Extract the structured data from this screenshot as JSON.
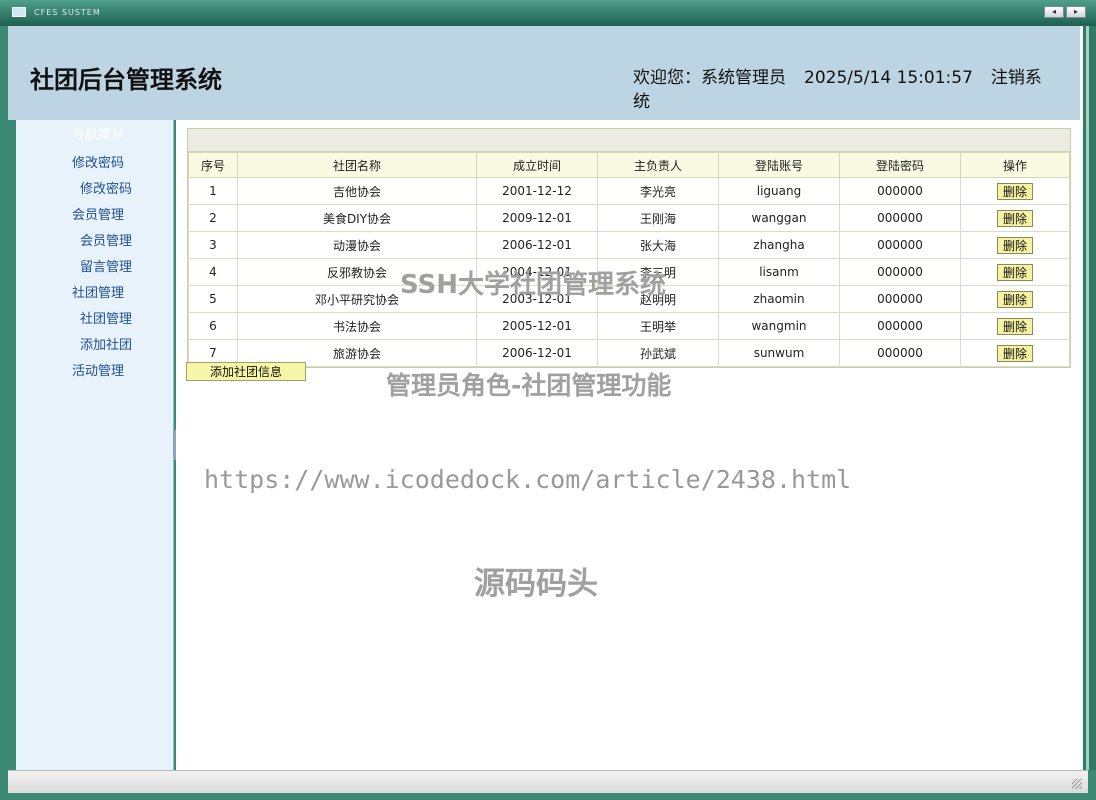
{
  "window": {
    "app_title": "CFES SUSTEM",
    "btn_prev": "◂",
    "btn_next": "▸"
  },
  "header": {
    "title": "社团后台管理系统",
    "welcome": "欢迎您：系统管理员",
    "datetime": "2025/5/14 15:01:57",
    "logout": "注销系统"
  },
  "sidebar": {
    "nav_title": "导航菜单",
    "items": [
      {
        "label": "修改密码"
      },
      {
        "label": "修改密码"
      },
      {
        "label": "会员管理"
      },
      {
        "label": "会员管理"
      },
      {
        "label": "留言管理"
      },
      {
        "label": "社团管理"
      },
      {
        "label": "社团管理"
      },
      {
        "label": "添加社团"
      },
      {
        "label": "活动管理"
      }
    ]
  },
  "table": {
    "headers": [
      "序号",
      "社团名称",
      "成立时间",
      "主负责人",
      "登陆账号",
      "登陆密码",
      "操作"
    ],
    "delete_label": "删除",
    "rows": [
      {
        "no": "1",
        "name": "吉他协会",
        "date": "2001-12-12",
        "leader": "李光亮",
        "account": "liguang",
        "password": "000000"
      },
      {
        "no": "2",
        "name": "美食DIY协会",
        "date": "2009-12-01",
        "leader": "王刚海",
        "account": "wanggan",
        "password": "000000"
      },
      {
        "no": "3",
        "name": "动漫协会",
        "date": "2006-12-01",
        "leader": "张大海",
        "account": "zhangha",
        "password": "000000"
      },
      {
        "no": "4",
        "name": "反邪教协会",
        "date": "2004-12-01",
        "leader": "李三明",
        "account": "lisanm",
        "password": "000000"
      },
      {
        "no": "5",
        "name": "邓小平研究协会",
        "date": "2003-12-01",
        "leader": "赵明明",
        "account": "zhaomin",
        "password": "000000"
      },
      {
        "no": "6",
        "name": "书法协会",
        "date": "2005-12-01",
        "leader": "王明举",
        "account": "wangmin",
        "password": "000000"
      },
      {
        "no": "7",
        "name": "旅游协会",
        "date": "2006-12-01",
        "leader": "孙武斌",
        "account": "sunwum",
        "password": "000000"
      }
    ]
  },
  "add_button": "添加社团信息",
  "watermarks": {
    "line1": "SSH大学社团管理系统",
    "line2": "管理员角色-社团管理功能",
    "line3": "https://www.icodedock.com/article/2438.html",
    "line4": "源码码头"
  }
}
